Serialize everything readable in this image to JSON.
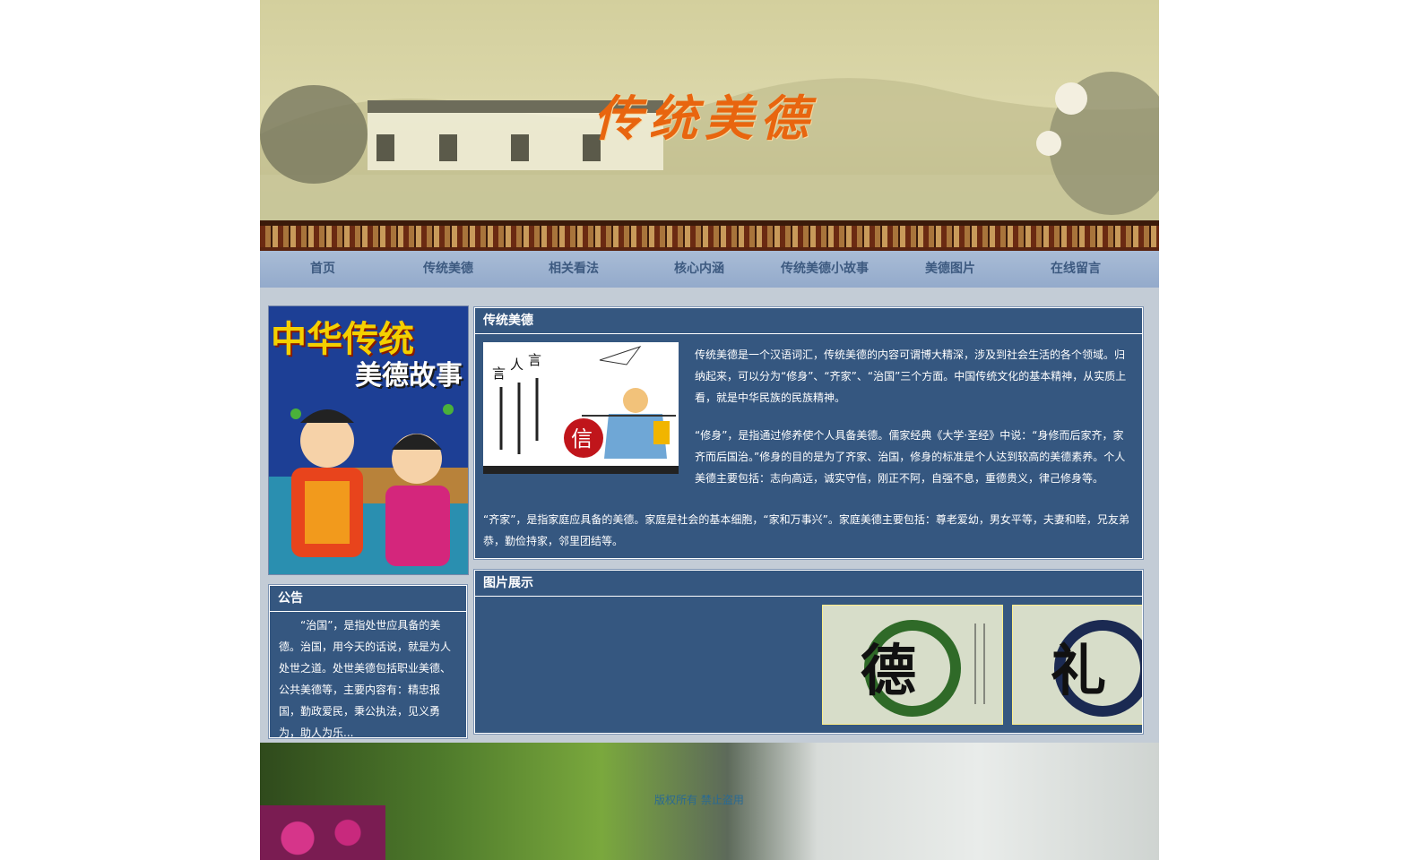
{
  "banner": {
    "title": "传统美德"
  },
  "nav": {
    "items": [
      "首页",
      "传统美德",
      "相关看法",
      "核心内涵",
      "传统美德小故事",
      "美德图片",
      "在线留言"
    ]
  },
  "left_image": {
    "line1": "中华传统",
    "line2": "美德故事"
  },
  "notice": {
    "title": "公告",
    "text": "“治国”，是指处世应具备的美德。治国，用今天的话说，就是为人处世之道。处世美德包括职业美德、公共美德等，主要内容有：精忠报国，勤政爱民，秉公执法，见义勇为，助人为乐..."
  },
  "virtue": {
    "title": "传统美德",
    "image_glyph": "信",
    "p1": "传统美德是一个汉语词汇，传统美德的内容可谓博大精深，涉及到社会生活的各个领域。归纳起来，可以分为“修身”、“齐家”、“治国”三个方面。中国传统文化的基本精神，从实质上看，就是中华民族的民族精神。",
    "p2": "“修身”，是指通过修养使个人具备美德。儒家经典《大学·圣经》中说：“身修而后家齐，家齐而后国治。”修身的目的是为了齐家、治国，修身的标准是个人达到较高的美德素养。个人美德主要包括：志向高远，诚实守信，刚正不阿，自强不息，重德贵义，律己修身等。",
    "p3": "“齐家”，是指家庭应具备的美德。家庭是社会的基本细胞，“家和万事兴”。家庭美德主要包括：尊老爱幼，男女平等，夫妻和睦，兄友弟恭，勤俭持家，邻里团结等。"
  },
  "gallery": {
    "title": "图片展示",
    "cards": [
      {
        "glyph": "德"
      },
      {
        "glyph": "礼"
      }
    ]
  },
  "footer": {
    "text": "版权所有 禁止盗用"
  },
  "colors": {
    "panel": "#355780",
    "nav": "#9bb0cf",
    "banner_title": "#e8650f"
  }
}
